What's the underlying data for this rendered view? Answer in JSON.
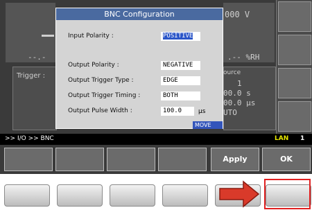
{
  "background": {
    "top_value": "000 V",
    "left_value": "--.-",
    "rh_value": ".-- %RH",
    "trigger_label": "Trigger :",
    "source_label": "ource",
    "source_lines": [
      "1",
      "00.0 s",
      "00.0 µs",
      "UTO"
    ]
  },
  "dialog": {
    "title": "BNC Configuration",
    "input_polarity_label": "Input Polarity :",
    "input_polarity_value": "POSITIVE",
    "output_polarity_label": "Output Polarity :",
    "output_polarity_value": "NEGATIVE",
    "output_trigger_type_label": "Output Trigger Type :",
    "output_trigger_type_value": "EDGE",
    "output_trigger_timing_label": "Output Trigger Timing :",
    "output_trigger_timing_value": "BOTH",
    "output_pulse_width_label": "Output Pulse Width :",
    "output_pulse_width_value": "100.0",
    "output_pulse_width_unit": "µs",
    "move_label": "MOVE"
  },
  "status": {
    "path": ">> I/O >> BNC",
    "lan": "LAN",
    "lan_number": "1"
  },
  "softkeys": [
    "",
    "",
    "",
    "",
    "Apply",
    "OK"
  ],
  "colors": {
    "highlight": "#e02020",
    "arrow": "#d93a2a",
    "title_bar": "#4a6aa0"
  },
  "icons": {
    "arrow": "right-arrow-icon"
  }
}
